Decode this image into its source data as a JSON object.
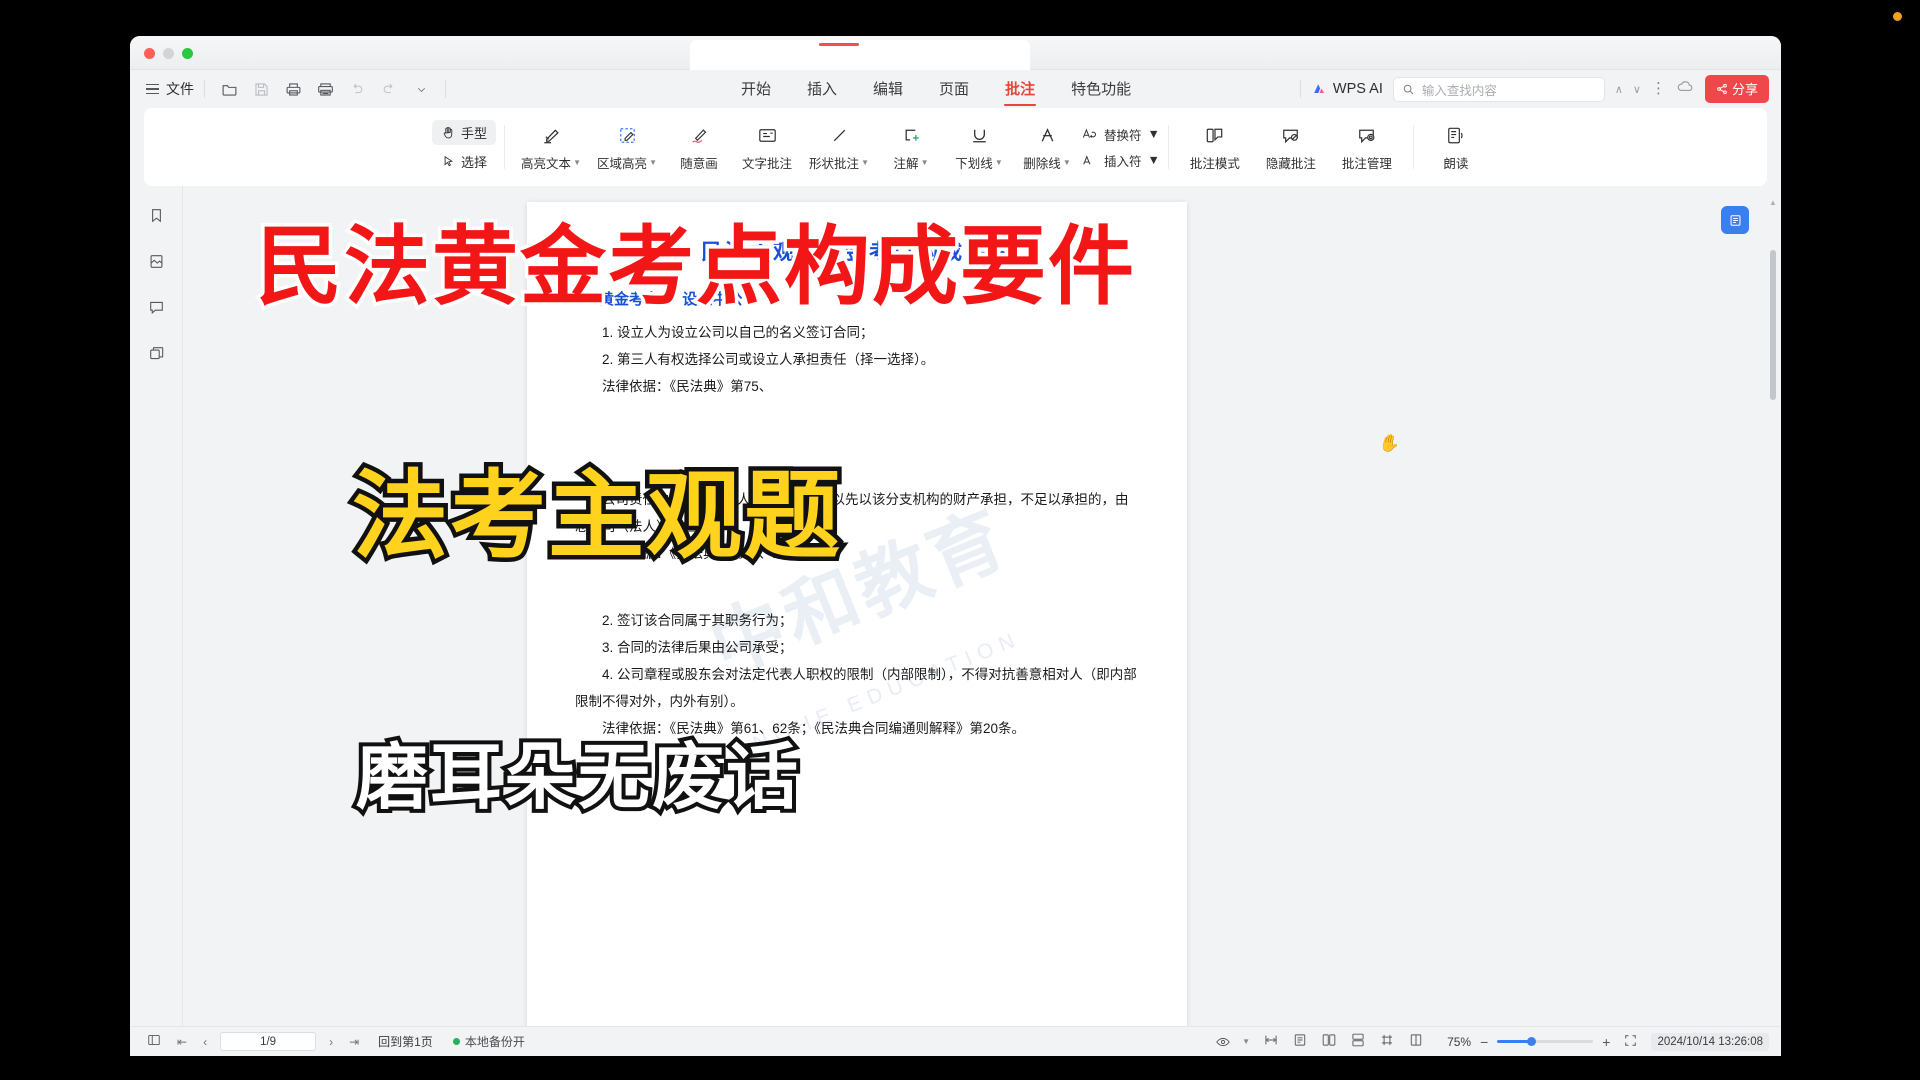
{
  "window": {
    "traffic_lights": [
      "close",
      "minimize",
      "zoom"
    ]
  },
  "menu": {
    "file_label": "文件",
    "quick_icons": [
      "open-folder-icon",
      "save-icon",
      "print-icon",
      "print-preview-icon",
      "undo-icon",
      "redo-icon",
      "more-chevron-icon"
    ]
  },
  "tabs": [
    {
      "label": "开始",
      "active": false
    },
    {
      "label": "插入",
      "active": false
    },
    {
      "label": "编辑",
      "active": false
    },
    {
      "label": "页面",
      "active": false
    },
    {
      "label": "批注",
      "active": true
    },
    {
      "label": "特色功能",
      "active": false
    }
  ],
  "header_right": {
    "ai_label": "WPS AI",
    "search_placeholder": "输入查找内容",
    "search_value": "",
    "share_label": "分享",
    "chevron_up": "∧",
    "chevron_down": "∨",
    "kebab": "⋮"
  },
  "ribbon": {
    "mode_buttons": [
      {
        "label": "手型",
        "icon": "hand-icon",
        "active": true
      },
      {
        "label": "选择",
        "icon": "cursor-arrow-icon",
        "active": false
      }
    ],
    "tools": [
      {
        "label": "高亮文本",
        "icon": "highlight-text-icon",
        "caret": true
      },
      {
        "label": "区域高亮",
        "icon": "area-highlight-icon",
        "caret": true
      },
      {
        "label": "随意画",
        "icon": "freehand-draw-icon",
        "caret": false
      },
      {
        "label": "文字批注",
        "icon": "text-comment-icon",
        "caret": false
      },
      {
        "label": "形状批注",
        "icon": "shape-comment-icon",
        "caret": true
      },
      {
        "label": "注解",
        "icon": "note-icon",
        "caret": true
      },
      {
        "label": "下划线",
        "icon": "underline-icon",
        "caret": true
      },
      {
        "label": "删除线",
        "icon": "strikethrough-icon",
        "caret": true
      }
    ],
    "stack_tools": [
      {
        "label": "替换符",
        "icon": "replace-mark-icon",
        "caret": true
      },
      {
        "label": "插入符",
        "icon": "insert-mark-icon",
        "caret": true
      }
    ],
    "manage_tools": [
      {
        "label": "批注模式",
        "icon": "comment-mode-icon"
      },
      {
        "label": "隐藏批注",
        "icon": "hide-comment-icon"
      },
      {
        "label": "批注管理",
        "icon": "comment-manage-icon"
      }
    ],
    "read_tool": {
      "label": "朗读",
      "icon": "read-aloud-icon"
    }
  },
  "left_rail": [
    {
      "name": "bookmark-icon"
    },
    {
      "name": "thumbnail-icon"
    },
    {
      "name": "comment-icon"
    },
    {
      "name": "layers-icon"
    }
  ],
  "document": {
    "title": "民法主观题黄金考点构成要件",
    "watermark": "中和教育",
    "watermark_sub": "ZHONGHE  EDUCATION",
    "sections": [
      {
        "heading": "黄金考点1：设立中公司",
        "items": [
          "1. 设立人为设立公司以自己的名义签订合同；",
          "2. 第三人有权选择公司或设立人承担责任（择一选择）。"
        ],
        "law": "法律依据：《民法典》第75、"
      },
      {
        "heading": "",
        "items": [
          "公司责任由总公司（法人）承担，也可以先以该分支机构的财产承担，不足以承担的，由总公司（法人）承担。"
        ],
        "law": "法律依据：《民法典》第74、102条。"
      },
      {
        "heading": "",
        "items": [
          "2. 签订该合同属于其职务行为；",
          "3. 合同的法律后果由公司承受；",
          "4. 公司章程或股东会对法定代表人职权的限制（内部限制），不得对抗善意相对人（即内部限制不得对外，内外有别）。"
        ],
        "law": "法律依据：《民法典》第61、62条；《民法典合同编通则解释》第20条。"
      }
    ]
  },
  "captions": [
    {
      "text": "民法黄金考点构成要件",
      "color": "#f21616",
      "stroke": "#ffffff"
    },
    {
      "text": "法考主观题",
      "color": "#ffd21e",
      "stroke": "#111111"
    },
    {
      "text": "磨耳朵无废话",
      "color": "#ffffff",
      "stroke": "#111111"
    }
  ],
  "status_bar": {
    "page_indicator": "1/9",
    "first_page_icon": "first-page-icon",
    "prev_page_icon": "prev-page-icon",
    "next_page_icon": "next-page-icon",
    "last_page_icon": "last-page-icon",
    "back_to_first": "回到第1页",
    "backup_label": "本地备份开",
    "eye_icon": "eye-icon",
    "view_icons": [
      "fit-page-icon",
      "single-page-icon",
      "two-page-icon",
      "continuous-icon",
      "flow-icon",
      "crop-icon",
      "reflow-icon"
    ],
    "zoom_out": "−",
    "zoom_in": "+",
    "zoom_level": "75%",
    "fullscreen_icon": "fullscreen-icon",
    "timestamp": "2024/10/14 13:26:08"
  }
}
